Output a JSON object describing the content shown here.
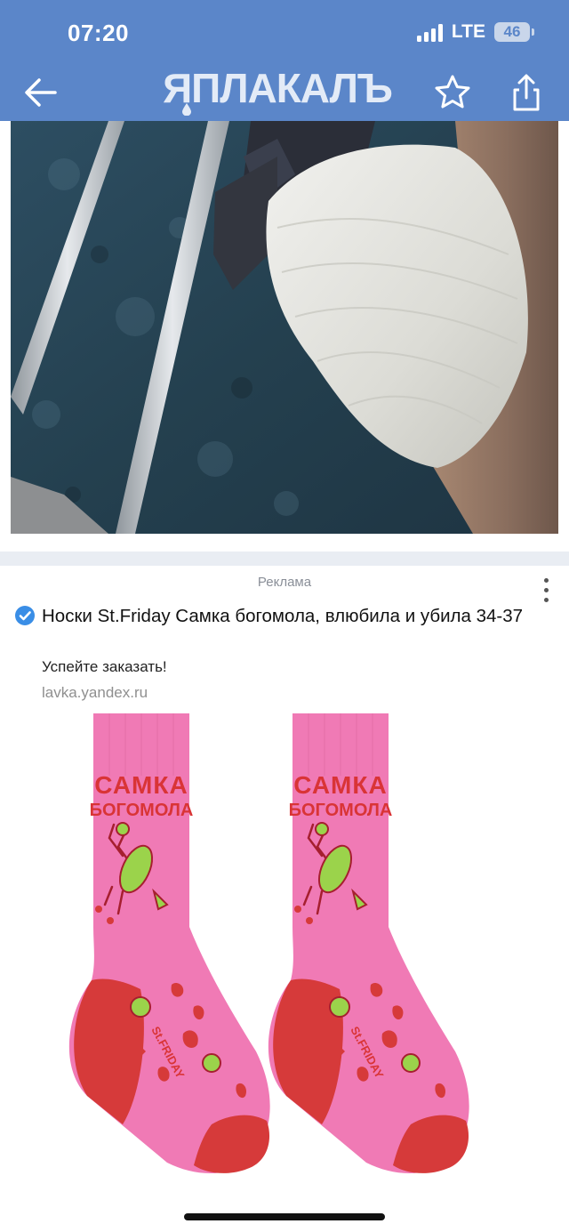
{
  "status": {
    "time": "07:20",
    "network": "LTE",
    "battery": "46"
  },
  "header": {
    "logo": "ЯПЛАКАЛЪ"
  },
  "icons": {
    "back": "arrow-left-icon",
    "favorite": "star-icon",
    "share": "share-icon",
    "verified": "verified-check-icon",
    "more": "more-vertical-icon"
  },
  "ad": {
    "label": "Реклама",
    "title": "Носки St.Friday Самка богомола, влюбила и убила 34-37",
    "subtitle": "Успейте заказать!",
    "domain": "lavka.yandex.ru",
    "sock_text_line1": "САМКА",
    "sock_text_line2": "БОГОМОЛА",
    "brand": "St.FRIDAY"
  },
  "colors": {
    "header": "#5b86c9",
    "sock_pink": "#f07ab5",
    "sock_red": "#d63a3a",
    "accent_blue": "#3a8ee6"
  }
}
